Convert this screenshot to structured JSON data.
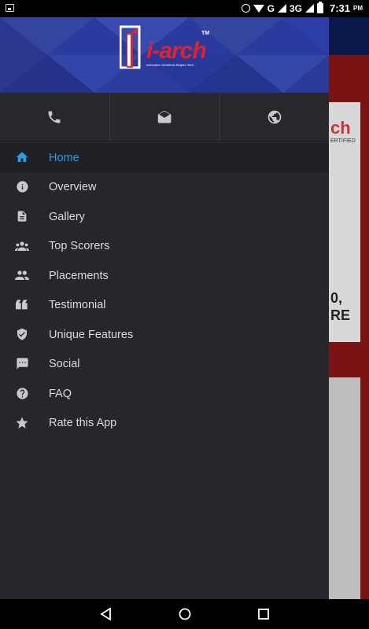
{
  "status_bar": {
    "network_label": "G",
    "network2_label": "3G",
    "time": "7:31",
    "ampm": "PM"
  },
  "header": {
    "logo_text": "i-arch",
    "logo_tm": "TM",
    "logo_tagline": "Innovative Architects Begins Here...",
    "colors": {
      "brand_red": "#e1222b",
      "header_blue": "#2b3a9e"
    }
  },
  "contact": {
    "phone_icon": "phone-icon",
    "mail_icon": "mail-icon",
    "web_icon": "globe-icon"
  },
  "menu": {
    "items": [
      {
        "label": "Home",
        "icon": "home-icon",
        "active": true
      },
      {
        "label": "Overview",
        "icon": "info-icon"
      },
      {
        "label": "Gallery",
        "icon": "document-icon"
      },
      {
        "label": "Top Scorers",
        "icon": "group-icon"
      },
      {
        "label": "Placements",
        "icon": "people-icon"
      },
      {
        "label": "Testimonial",
        "icon": "quote-icon"
      },
      {
        "label": "Unique Features",
        "icon": "shield-check-icon"
      },
      {
        "label": "Social",
        "icon": "chat-icon"
      },
      {
        "label": "FAQ",
        "icon": "help-icon"
      },
      {
        "label": "Rate this App",
        "icon": "star-icon"
      }
    ],
    "colors": {
      "active": "#2c9be0",
      "text": "#d9dbe0",
      "icon": "#c8cad0"
    }
  },
  "background_app": {
    "card_text_top": "ch",
    "card_text_sub": "ERTIFIED",
    "card_text_bottom": "0,\nRE"
  }
}
